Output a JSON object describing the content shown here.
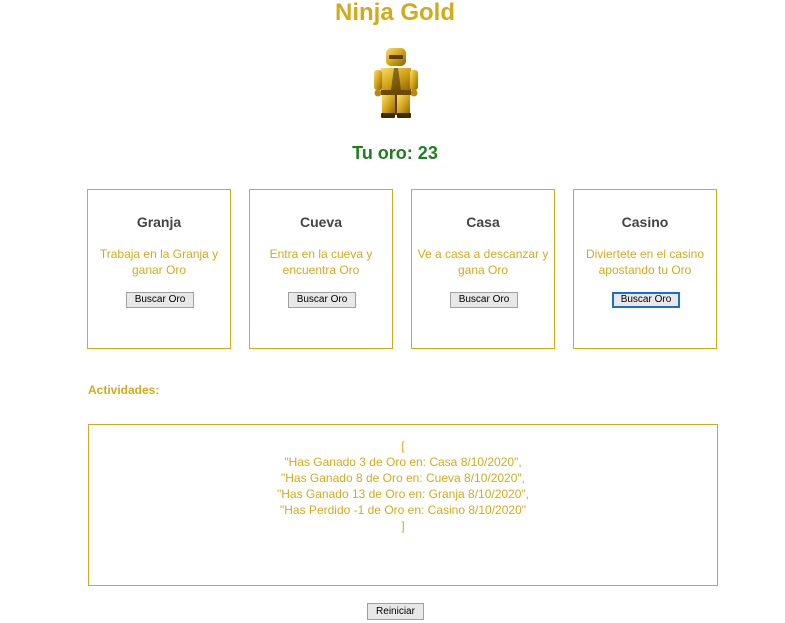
{
  "page": {
    "title": "Ninja Gold",
    "gold_label": "Tu oro: 23"
  },
  "locations": [
    {
      "name": "Granja",
      "description": "Trabaja en la Granja y ganar Oro",
      "button": "Buscar Oro"
    },
    {
      "name": "Cueva",
      "description": "Entra en la cueva y encuentra Oro",
      "button": "Buscar Oro"
    },
    {
      "name": "Casa",
      "description": "Ve a casa a descanzar y gana Oro",
      "button": "Buscar Oro"
    },
    {
      "name": "Casino",
      "description": "Diviertete en el casino apostando tu Oro",
      "button": "Buscar Oro"
    }
  ],
  "activities": {
    "label": "Actividades:",
    "log": "[\n\"Has Ganado 3 de Oro en: Casa 8/10/2020\",\n\"Has Ganado 8 de Oro en: Cueva 8/10/2020\",\n\"Has Ganado 13 de Oro en: Granja 8/10/2020\",\n\"Has Perdido -1 de Oro en: Casino 8/10/2020\"\n]"
  },
  "reset_button": "Reiniciar",
  "colors": {
    "gold": "#d2ab1c",
    "gold_count": "#1e7f1e",
    "card_title": "#444444",
    "focus": "#1a6fc9"
  },
  "icons": {
    "ninja": "gold-ninja-figure-icon"
  }
}
